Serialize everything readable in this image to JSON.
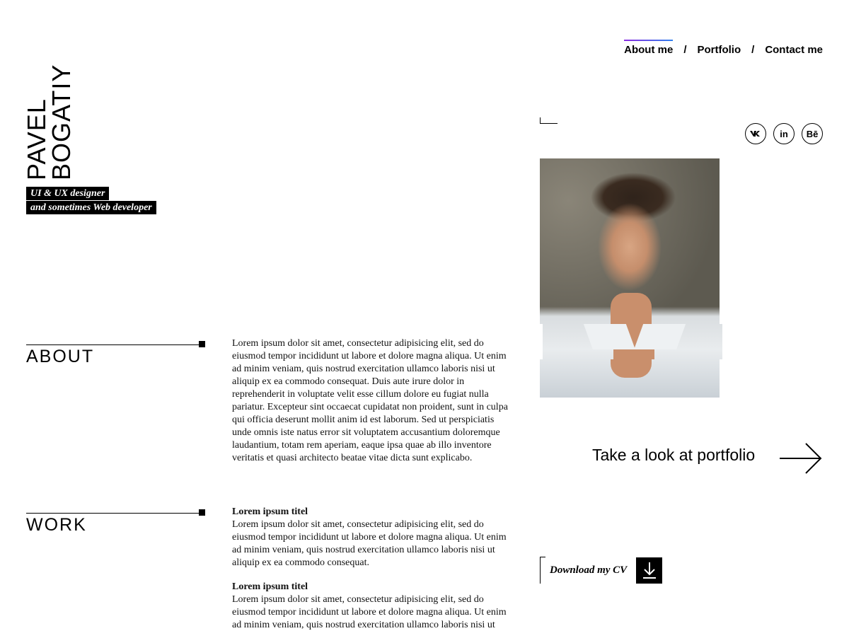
{
  "header": {
    "name_line1": "PAVEL",
    "name_line2": "BOGATIY",
    "tagline_line1": "UI & UX designer",
    "tagline_line2": "and sometimes Web developer"
  },
  "nav": {
    "items": [
      {
        "label": "About me",
        "active": true
      },
      {
        "label": "Portfolio",
        "active": false
      },
      {
        "label": "Contact me",
        "active": false
      }
    ],
    "separator": "/",
    "accent_gradient": [
      "#8a2be2",
      "#2f80ed"
    ]
  },
  "social": [
    {
      "icon": "vk-icon",
      "glyph": "vk"
    },
    {
      "icon": "linkedin-icon",
      "glyph": "in"
    },
    {
      "icon": "behance-icon",
      "glyph": "Bē"
    }
  ],
  "about": {
    "heading": "ABOUT",
    "text": "Lorem ipsum dolor sit amet, consectetur adipisicing elit, sed do eiusmod tempor incididunt ut labore et dolore magna aliqua. Ut enim ad minim veniam, quis nostrud exercitation ullamco laboris nisi ut aliquip ex ea commodo consequat. Duis aute irure dolor in reprehenderit in voluptate velit esse cillum dolore eu fugiat nulla pariatur. Excepteur sint occaecat cupidatat non proident, sunt in culpa qui officia deserunt mollit anim id est laborum. Sed ut perspiciatis unde omnis iste natus error sit voluptatem accusantium doloremque laudantium, totam rem aperiam, eaque ipsa quae ab illo inventore veritatis et quasi architecto beatae vitae dicta sunt explicabo."
  },
  "work": {
    "heading": "WORK",
    "items": [
      {
        "title": "Lorem ipsum titel",
        "text": "Lorem ipsum dolor sit amet, consectetur adipisicing elit, sed do eiusmod tempor incididunt ut labore et dolore magna aliqua. Ut enim ad minim veniam, quis nostrud exercitation ullamco laboris nisi ut aliquip ex ea commodo consequat."
      },
      {
        "title": "Lorem ipsum titel",
        "text": "Lorem ipsum dolor sit amet, consectetur adipisicing elit, sed do eiusmod tempor incididunt ut labore et dolore magna aliqua. Ut enim ad minim veniam, quis nostrud exercitation ullamco laboris nisi ut"
      }
    ]
  },
  "portfolio_link": {
    "label": "Take a look at portfolio",
    "icon": "arrow-right-icon"
  },
  "cv": {
    "label": "Download my CV",
    "icon": "download-icon"
  }
}
